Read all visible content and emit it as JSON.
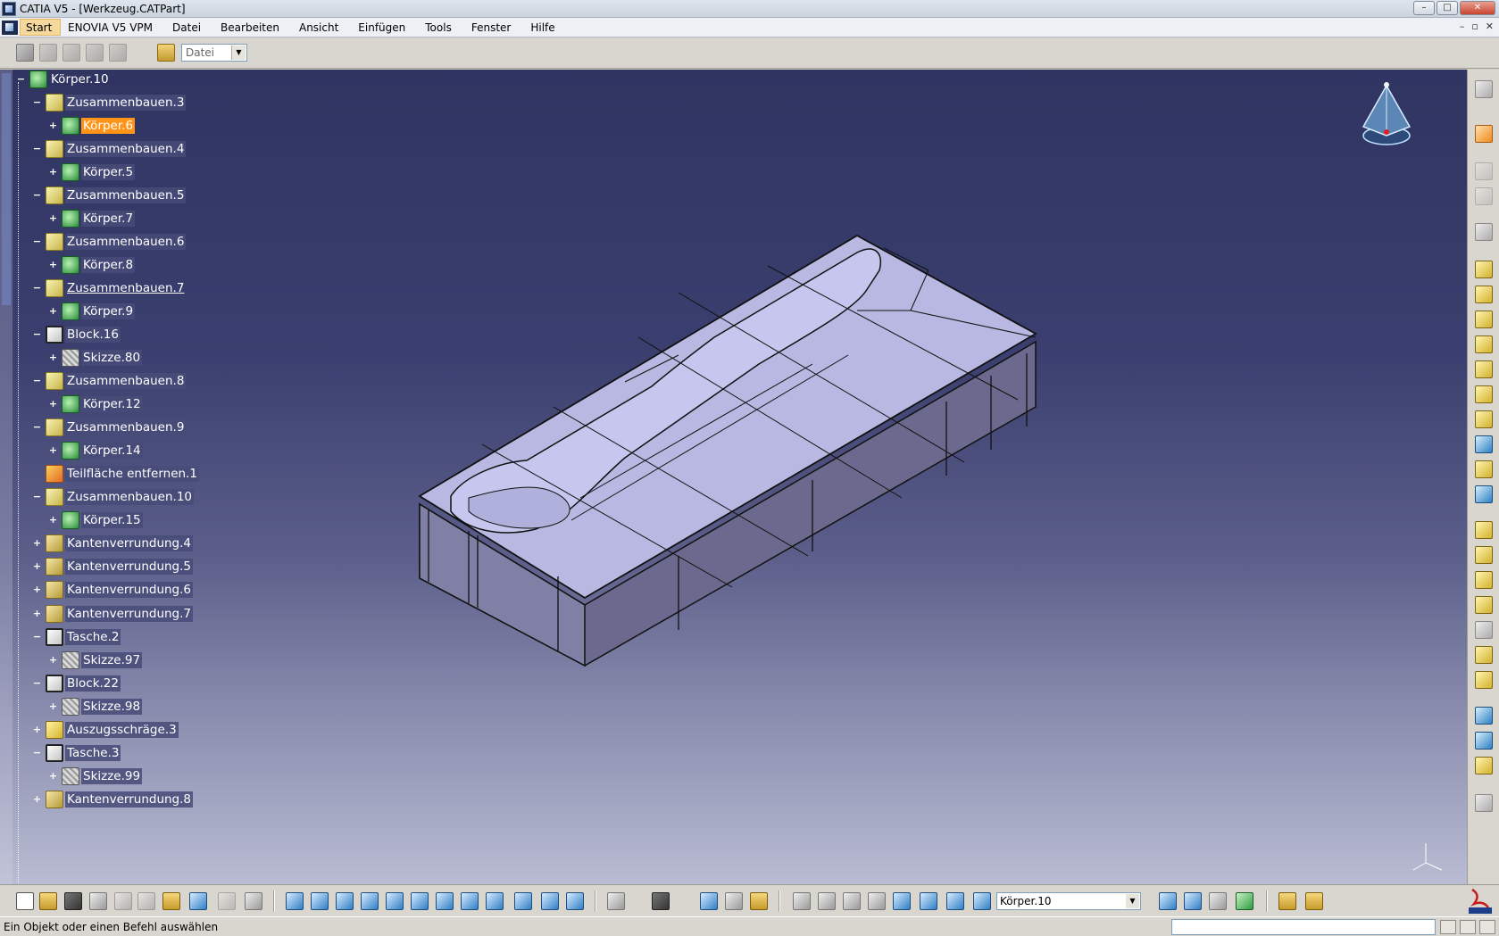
{
  "window": {
    "title": "CATIA V5 - [Werkzeug.CATPart]",
    "controls": [
      "–",
      "□",
      "✕"
    ]
  },
  "menubar": {
    "start": "Start",
    "items": [
      "ENOVIA V5 VPM",
      "Datei",
      "Bearbeiten",
      "Ansicht",
      "Einfügen",
      "Tools",
      "Fenster",
      "Hilfe"
    ],
    "mdi_controls": [
      "–",
      "▫",
      "✕"
    ]
  },
  "top_toolbar": {
    "file_combo_value": "Datei"
  },
  "tree": {
    "nodes": [
      {
        "label": "Körper.10",
        "icon": "body-icon",
        "expander": "−"
      },
      {
        "label": "Zusammenbauen.3",
        "icon": "assemble-icon",
        "expander": "−"
      },
      {
        "label": "Körper.6",
        "icon": "body-icon",
        "expander": "+",
        "selected": true
      },
      {
        "label": "Zusammenbauen.4",
        "icon": "assemble-icon",
        "expander": "−"
      },
      {
        "label": "Körper.5",
        "icon": "body-icon",
        "expander": "+"
      },
      {
        "label": "Zusammenbauen.5",
        "icon": "assemble-icon",
        "expander": "−"
      },
      {
        "label": "Körper.7",
        "icon": "body-icon",
        "expander": "+"
      },
      {
        "label": "Zusammenbauen.6",
        "icon": "assemble-icon",
        "expander": "−"
      },
      {
        "label": "Körper.8",
        "icon": "body-icon",
        "expander": "+"
      },
      {
        "label": "Zusammenbauen.7",
        "icon": "assemble-icon",
        "expander": "−",
        "underlined": true
      },
      {
        "label": "Körper.9",
        "icon": "body-icon",
        "expander": "+"
      },
      {
        "label": "Block.16",
        "icon": "block-icon",
        "expander": "−"
      },
      {
        "label": "Skizze.80",
        "icon": "sketch-icon",
        "expander": "+"
      },
      {
        "label": "Zusammenbauen.8",
        "icon": "assemble-icon",
        "expander": "−"
      },
      {
        "label": "Körper.12",
        "icon": "body-icon",
        "expander": "+"
      },
      {
        "label": "Zusammenbauen.9",
        "icon": "assemble-icon",
        "expander": "−"
      },
      {
        "label": "Körper.14",
        "icon": "body-icon",
        "expander": "+"
      },
      {
        "label": "Teilfläche entfernen.1",
        "icon": "remove-face-icon",
        "expander": ""
      },
      {
        "label": "Zusammenbauen.10",
        "icon": "assemble-icon",
        "expander": "−"
      },
      {
        "label": "Körper.15",
        "icon": "body-icon",
        "expander": "+"
      },
      {
        "label": "Kantenverrundung.4",
        "icon": "fillet-icon",
        "expander": "+"
      },
      {
        "label": "Kantenverrundung.5",
        "icon": "fillet-icon",
        "expander": "+"
      },
      {
        "label": "Kantenverrundung.6",
        "icon": "fillet-icon",
        "expander": "+"
      },
      {
        "label": "Kantenverrundung.7",
        "icon": "fillet-icon",
        "expander": "+"
      },
      {
        "label": "Tasche.2",
        "icon": "pocket-icon",
        "expander": "−"
      },
      {
        "label": "Skizze.97",
        "icon": "sketch-icon",
        "expander": "+"
      },
      {
        "label": "Block.22",
        "icon": "block-icon",
        "expander": "−"
      },
      {
        "label": "Skizze.98",
        "icon": "sketch-icon",
        "expander": "+"
      },
      {
        "label": "Auszugsschräge.3",
        "icon": "draft-icon",
        "expander": "+"
      },
      {
        "label": "Tasche.3",
        "icon": "pocket-icon",
        "expander": "−"
      },
      {
        "label": "Skizze.99",
        "icon": "sketch-icon",
        "expander": "+"
      },
      {
        "label": "Kantenverrundung.8",
        "icon": "fillet-icon",
        "expander": "+"
      }
    ]
  },
  "bottom_toolbar": {
    "body_combo_value": "Körper.10"
  },
  "statusbar": {
    "message": "Ein Objekt oder einen Befehl auswählen"
  },
  "colors": {
    "selection": "#ff9418",
    "viewport_top": "#303461",
    "viewport_bottom": "#b9bcd2",
    "part_face": "#b6b6e0"
  }
}
